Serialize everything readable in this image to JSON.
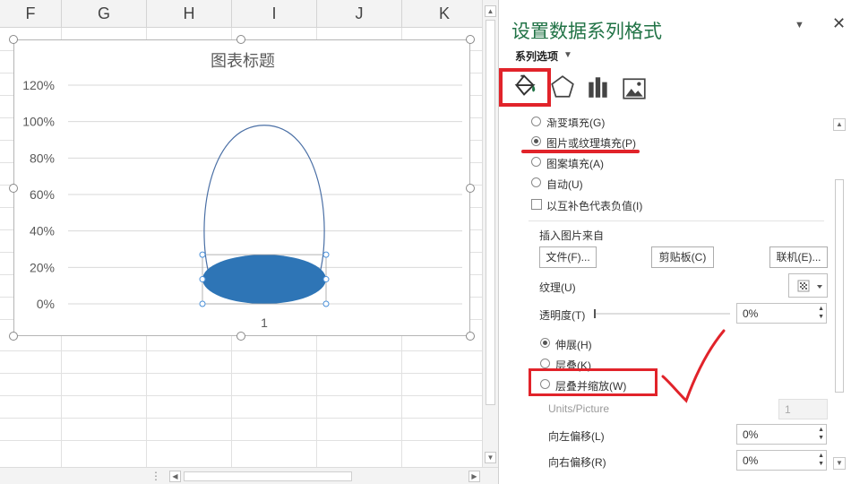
{
  "sheet": {
    "columns": [
      "F",
      "G",
      "H",
      "I",
      "J",
      "K"
    ]
  },
  "chart": {
    "title": "图表标题",
    "y_ticks": [
      "120%",
      "100%",
      "80%",
      "60%",
      "40%",
      "20%",
      "0%"
    ],
    "x_category": "1",
    "fill_color": "#2e75b6",
    "outline_color": "#4a6fa5"
  },
  "chart_data": {
    "type": "bar",
    "title": "图表标题",
    "categories": [
      "1"
    ],
    "series": [
      {
        "values": [
          0.27
        ]
      }
    ],
    "outline_top": 0.98,
    "ylim": [
      0,
      1.2
    ],
    "grid": true,
    "y_format": "percent"
  },
  "pane": {
    "title": "设置数据系列格式",
    "series_options": "系列选项",
    "tabs": [
      "fill-line",
      "effects",
      "series-options",
      "picture"
    ],
    "fill_options": [
      {
        "label": "渐变填充(G)",
        "selected": false
      },
      {
        "label": "图片或纹理填充(P)",
        "selected": true
      },
      {
        "label": "图案填充(A)",
        "selected": false
      },
      {
        "label": "自动(U)",
        "selected": false
      }
    ],
    "invert_label": "以互补色代表负值(I)",
    "insert_from": "插入图片来自",
    "buttons": {
      "file": "文件(F)...",
      "clipboard": "剪贴板(C)",
      "online": "联机(E)..."
    },
    "texture_label": "纹理(U)",
    "transparency_label": "透明度(T)",
    "transparency_value": "0%",
    "stretch_options": [
      {
        "label": "伸展(H)",
        "selected": true
      },
      {
        "label": "层叠(K)",
        "selected": false
      },
      {
        "label": "层叠并缩放(W)",
        "selected": false
      }
    ],
    "units_label": "Units/Picture",
    "units_value": "1",
    "offset_left_label": "向左偏移(L)",
    "offset_left_value": "0%",
    "offset_right_label": "向右偏移(R)",
    "offset_right_value": "0%"
  },
  "annotation_color": "#e1232a"
}
